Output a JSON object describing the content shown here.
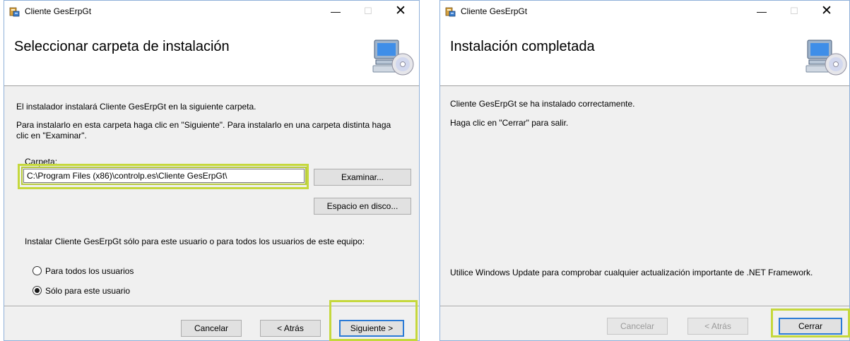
{
  "window1": {
    "title": "Cliente GesErpGt",
    "controls": {
      "minimize": "—",
      "maximize": "☐",
      "close": "✕"
    },
    "heading": "Seleccionar carpeta de instalación",
    "intro": "El instalador instalará Cliente GesErpGt en la siguiente carpeta.",
    "instruction_line1": "Para instalarlo en esta carpeta haga clic en \"Siguiente\". Para instalarlo en una carpeta distinta haga",
    "instruction_line2": "clic en \"Examinar\".",
    "folder_label": "Carpeta:",
    "folder_value": "C:\\Program Files (x86)\\controlp.es\\Cliente GesErpGt\\",
    "browse_label": "Examinar...",
    "disk_space_label": "Espacio en disco...",
    "scope_question": "Instalar Cliente GesErpGt sólo para este usuario o para todos los usuarios de este equipo:",
    "options": [
      {
        "label": "Para todos los usuarios",
        "selected": false
      },
      {
        "label": "Sólo para este usuario",
        "selected": true
      }
    ],
    "buttons": {
      "cancel": "Cancelar",
      "back": "< Atrás",
      "next": "Siguiente >"
    }
  },
  "window2": {
    "title": "Cliente GesErpGt",
    "controls": {
      "minimize": "—",
      "maximize": "☐",
      "close": "✕"
    },
    "heading": "Instalación completada",
    "success": "Cliente GesErpGt se ha instalado correctamente.",
    "exit_hint": "Haga clic en \"Cerrar\" para salir.",
    "update_note": "Utilice Windows Update para comprobar cualquier actualización importante de .NET Framework.",
    "buttons": {
      "cancel": "Cancelar",
      "back": "< Atrás",
      "close": "Cerrar"
    }
  },
  "icons": [
    "installer-app-icon",
    "computer-disc-icon"
  ],
  "colors": {
    "highlight": "#c5d83c",
    "focus_border": "#2b7bd6",
    "dialog_bg": "#f0f0f0"
  }
}
